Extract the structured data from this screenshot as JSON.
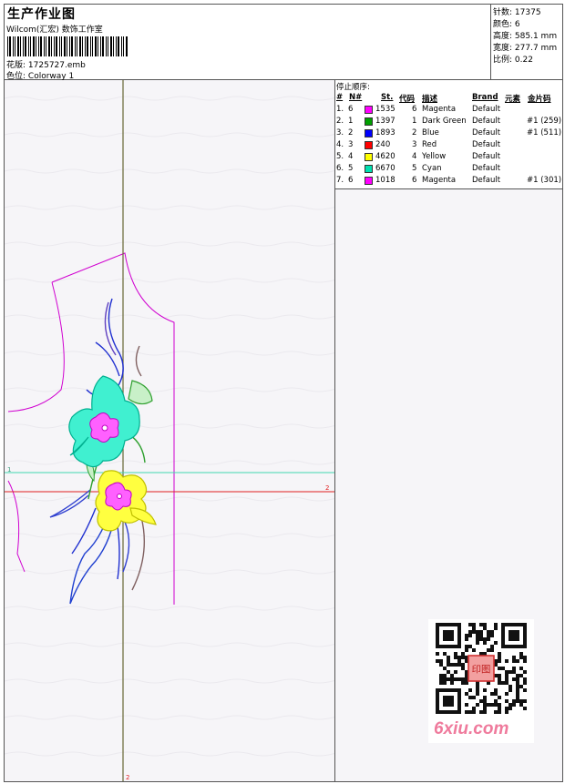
{
  "header": {
    "title": "生产作业图",
    "studio": "Wilcom(汇宏) 数饰工作室",
    "design_label": "花版:",
    "design_value": "1725727.emb",
    "colorway_label": "色位:",
    "colorway_value": "Colorway 1"
  },
  "stats": {
    "stitches_label": "针数:",
    "stitches_value": "17375",
    "colors_label": "颜色:",
    "colors_value": "6",
    "height_label": "高度:",
    "height_value": "585.1 mm",
    "width_label": "宽度:",
    "width_value": "277.7 mm",
    "scale_label": "比例:",
    "scale_value": "0.22"
  },
  "stop_sequence": {
    "title": "停止顺序:",
    "headers": {
      "hash": "#",
      "n": "N#",
      "st": "St.",
      "code": "代码",
      "desc": "描述",
      "brand": "Brand",
      "elem": "元素",
      "seq": "金片码"
    },
    "rows": [
      {
        "idx": "1.",
        "n": "6",
        "color": "#ff00ff",
        "st": "1535",
        "code": "6",
        "desc": "Magenta",
        "brand": "Default",
        "seq": ""
      },
      {
        "idx": "2.",
        "n": "1",
        "color": "#00a000",
        "st": "1397",
        "code": "1",
        "desc": "Dark Green",
        "brand": "Default",
        "seq": "#1 (259)"
      },
      {
        "idx": "3.",
        "n": "2",
        "color": "#0000ff",
        "st": "1893",
        "code": "2",
        "desc": "Blue",
        "brand": "Default",
        "seq": "#1 (511)"
      },
      {
        "idx": "4.",
        "n": "3",
        "color": "#ff0000",
        "st": "240",
        "code": "3",
        "desc": "Red",
        "brand": "Default",
        "seq": ""
      },
      {
        "idx": "5.",
        "n": "4",
        "color": "#ffff00",
        "st": "4620",
        "code": "4",
        "desc": "Yellow",
        "brand": "Default",
        "seq": ""
      },
      {
        "idx": "6.",
        "n": "5",
        "color": "#00e0b0",
        "st": "6670",
        "code": "5",
        "desc": "Cyan",
        "brand": "Default",
        "seq": ""
      },
      {
        "idx": "7.",
        "n": "6",
        "color": "#ff00ff",
        "st": "1018",
        "code": "6",
        "desc": "Magenta",
        "brand": "Default",
        "seq": "#1 (301)"
      }
    ]
  },
  "canvas": {
    "marker_1": "1",
    "marker_2": "2",
    "marker_3": "2"
  },
  "watermark": {
    "logo": "6xiu.com",
    "seal": "印图"
  }
}
